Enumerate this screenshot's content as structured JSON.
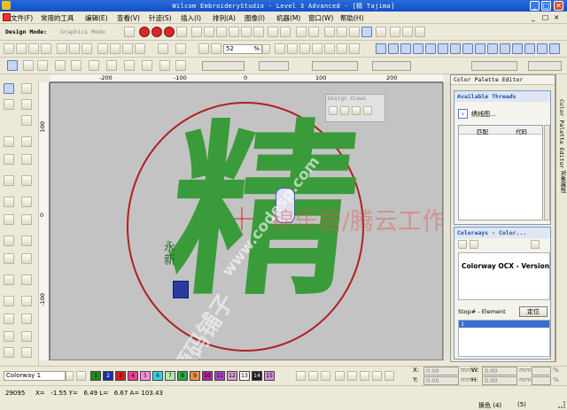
{
  "title_bar": {
    "title": "Wilcom EmbroideryStudio - Level 3 Advanced - [精         Tajima]",
    "minimize": "_",
    "maximize": "□",
    "close": "✕"
  },
  "menu": [
    "文件(F)",
    "常用的工具",
    "编辑(E)",
    "查看(V)",
    "针迹(S)",
    "插入(I)",
    "排列(A)",
    "图像(I)",
    "机器(M)",
    "窗口(W)",
    "帮助(H)"
  ],
  "menu_right": {
    "minimize": "_",
    "restore": "□",
    "close": "×"
  },
  "toolbar1": {
    "design_mode_label": "Design Mode:",
    "graphics_mode_label": "Graphics Mode"
  },
  "toolbar2": {
    "zoom_value": "52",
    "zoom_pct": "%"
  },
  "rulers": {
    "h_ticks": [
      "-200",
      "-100",
      "0",
      "100",
      "200"
    ],
    "v_ticks": [
      "100",
      "0",
      "-100"
    ]
  },
  "canvas": {
    "design_char": "精",
    "sig_chars": "永新",
    "seal_text": "印",
    "watermark_cn": "锦乐居/腾云工作室",
    "watermark_en": "www.codesp.com",
    "watermark_diag": "源码铺子",
    "colors": {
      "circle": "#b02020",
      "stitch": "#3a9b3a",
      "seal": "#2a3aa0"
    }
  },
  "floating_window": {
    "title": "Design Views"
  },
  "panel": {
    "header": "Color Palette Editor",
    "available_threads": "Available Threads",
    "thread_chart": "绣线图...",
    "col_match": "匹配",
    "col_code": "代码",
    "colorways_header": "Colorways - Color...",
    "ocx_text": "Colorway OCX - Version",
    "stop_label": "Stop# - Element",
    "locate_btn": "定位",
    "list_item": "1"
  },
  "side_tabs": {
    "tab1": "Color Palette Editor",
    "tab2": "对象属性"
  },
  "bottom": {
    "colorway_value": "Colorway 1",
    "swatches": [
      {
        "n": "1",
        "c": "#1e8c1e"
      },
      {
        "n": "2",
        "c": "#1c2fa8"
      },
      {
        "n": "3",
        "c": "#d81c1c"
      },
      {
        "n": "4",
        "c": "#f23e9a"
      },
      {
        "n": "5",
        "c": "#ff8ee0"
      },
      {
        "n": "6",
        "c": "#34d4e8"
      },
      {
        "n": "7",
        "c": "#b8e8b0"
      },
      {
        "n": "8",
        "c": "#2aa846"
      },
      {
        "n": "9",
        "c": "#f08f4a"
      },
      {
        "n": "10",
        "c": "#b0289c"
      },
      {
        "n": "11",
        "c": "#a048c8"
      },
      {
        "n": "12",
        "c": "#d8a0d0"
      },
      {
        "n": "13",
        "c": "#f8f8f8"
      },
      {
        "n": "14",
        "c": "#222222"
      },
      {
        "n": "15",
        "c": "#d88ce0"
      }
    ],
    "x_label": "X:",
    "y_label": "Y:",
    "w_label": "W:",
    "h_label": "H:",
    "x_value": "0.00",
    "y_value": "0.00",
    "w_value": "0.00",
    "h_value": "0.00",
    "mm": "mm",
    "pct": "%"
  },
  "status": {
    "stitches": "29095",
    "coords": "X=   -1.55 Y=   6.49 L=   6.67 A= 103.43",
    "color_change": "换色 (4) ",
    "stops": "(5)"
  }
}
